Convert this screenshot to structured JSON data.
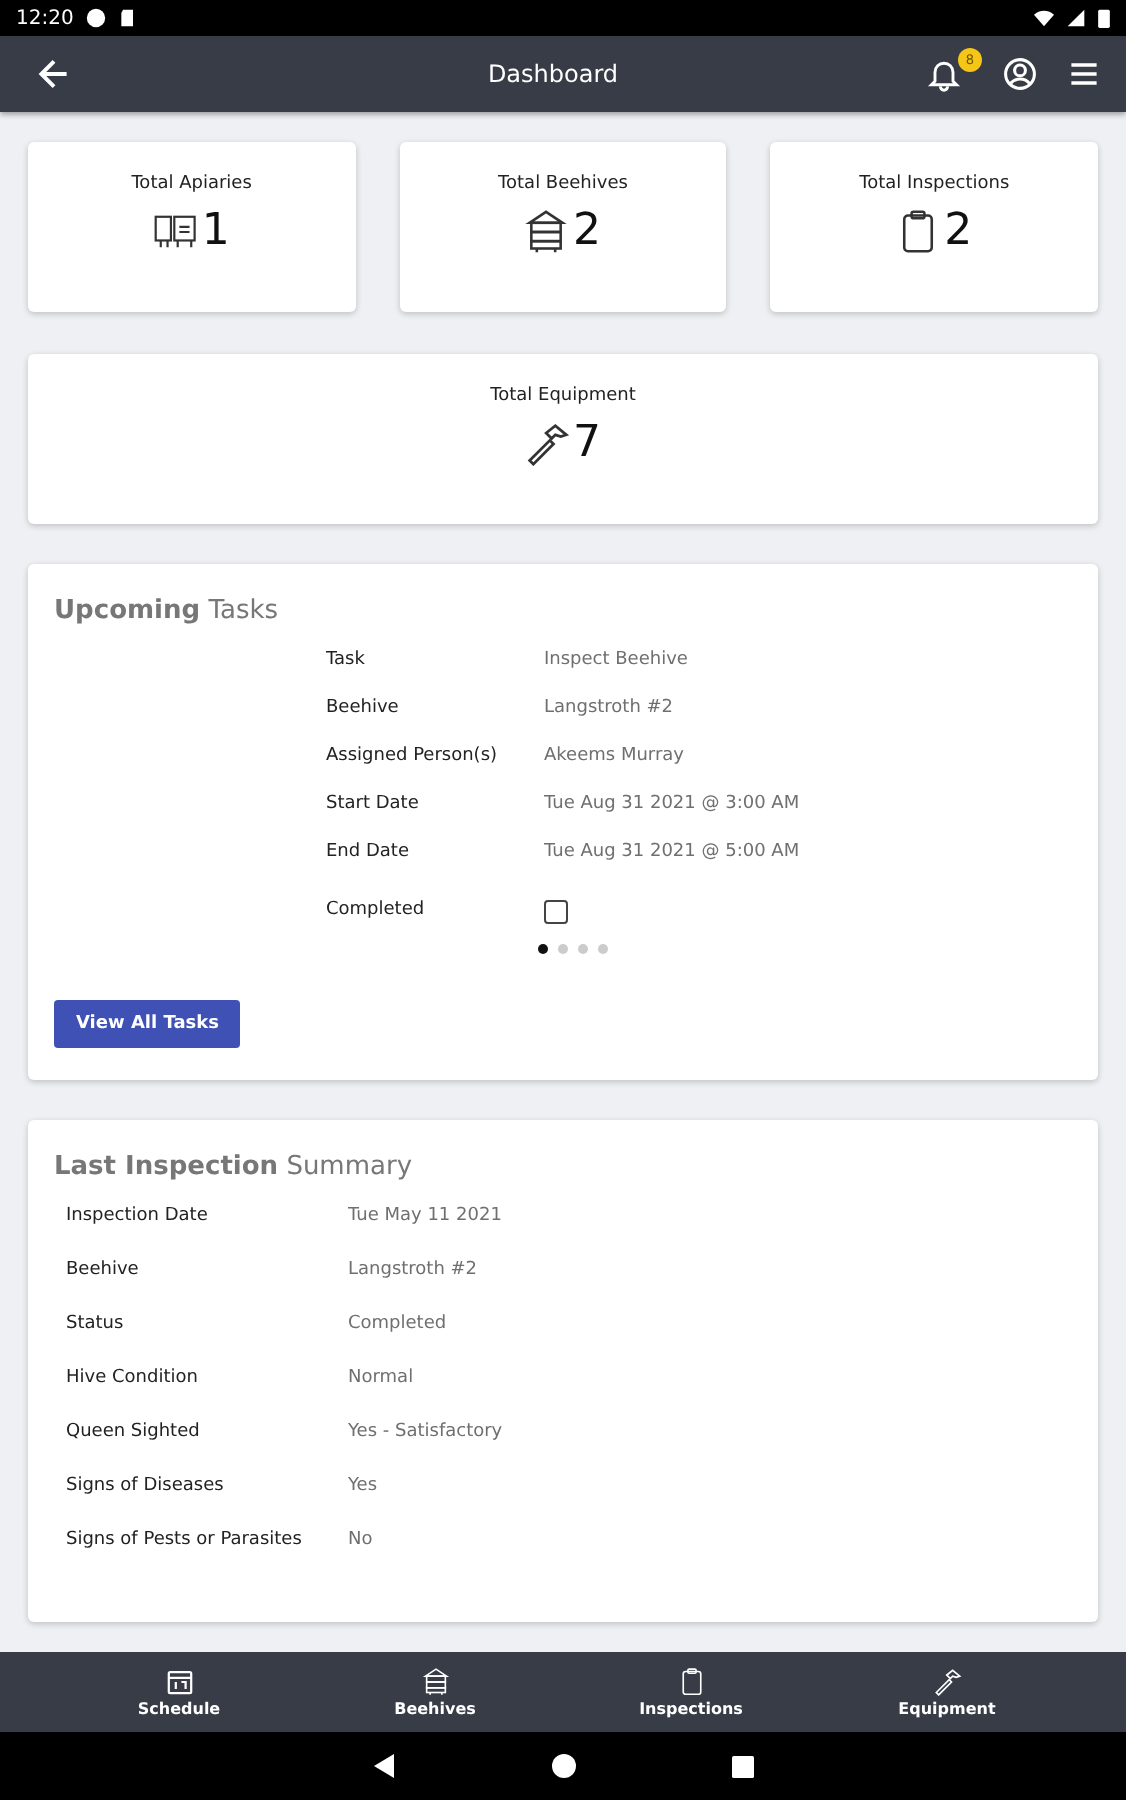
{
  "status_bar": {
    "time": "12:20"
  },
  "app_bar": {
    "title": "Dashboard",
    "notification_count": "8"
  },
  "stats": [
    {
      "kind": "apiary",
      "label": "Total Apiaries",
      "value": "1"
    },
    {
      "kind": "beehive",
      "label": "Total Beehives",
      "value": "2"
    },
    {
      "kind": "inspection",
      "label": "Total Inspections",
      "value": "2"
    },
    {
      "kind": "equipment",
      "label": "Total Equipment",
      "value": "7"
    }
  ],
  "upcoming_tasks": {
    "title": "**Upcoming** Tasks",
    "fields": [
      {
        "label": "Task",
        "value": "Inspect Beehive"
      },
      {
        "label": "Beehive",
        "value": "Langstroth #2"
      },
      {
        "label": "Assigned Person(s)",
        "value": "Akeems Murray"
      },
      {
        "label": "Start Date",
        "value": "Tue Aug 31 2021 @ 3:00 AM"
      },
      {
        "label": "End Date",
        "value": "Tue Aug 31 2021 @ 5:00 AM"
      }
    ],
    "completed": {
      "label": "Completed",
      "checked": false
    },
    "pages": [
      {
        "selected": true
      },
      {
        "selected": false
      },
      {
        "selected": false
      },
      {
        "selected": false
      }
    ],
    "button": "View All Tasks"
  },
  "last_inspection": {
    "title": "**Last Inspection** Summary",
    "fields": [
      {
        "label": "Inspection Date",
        "value": "Tue May 11 2021"
      },
      {
        "label": "Beehive",
        "value": "Langstroth #2"
      },
      {
        "label": "Status",
        "value": "Completed"
      },
      {
        "label": "Hive Condition",
        "value": "Normal"
      },
      {
        "label": "Queen Sighted",
        "value": "Yes - Satisfactory"
      },
      {
        "label": "Signs of Diseases",
        "value": "Yes"
      },
      {
        "label": "Signs of Pests or Parasites",
        "value": "No"
      }
    ]
  },
  "bottom_nav": [
    {
      "kind": "schedule",
      "label": "Schedule"
    },
    {
      "kind": "beehive",
      "label": "Beehives"
    },
    {
      "kind": "inspection",
      "label": "Inspections"
    },
    {
      "kind": "equipment",
      "label": "Equipment"
    }
  ]
}
